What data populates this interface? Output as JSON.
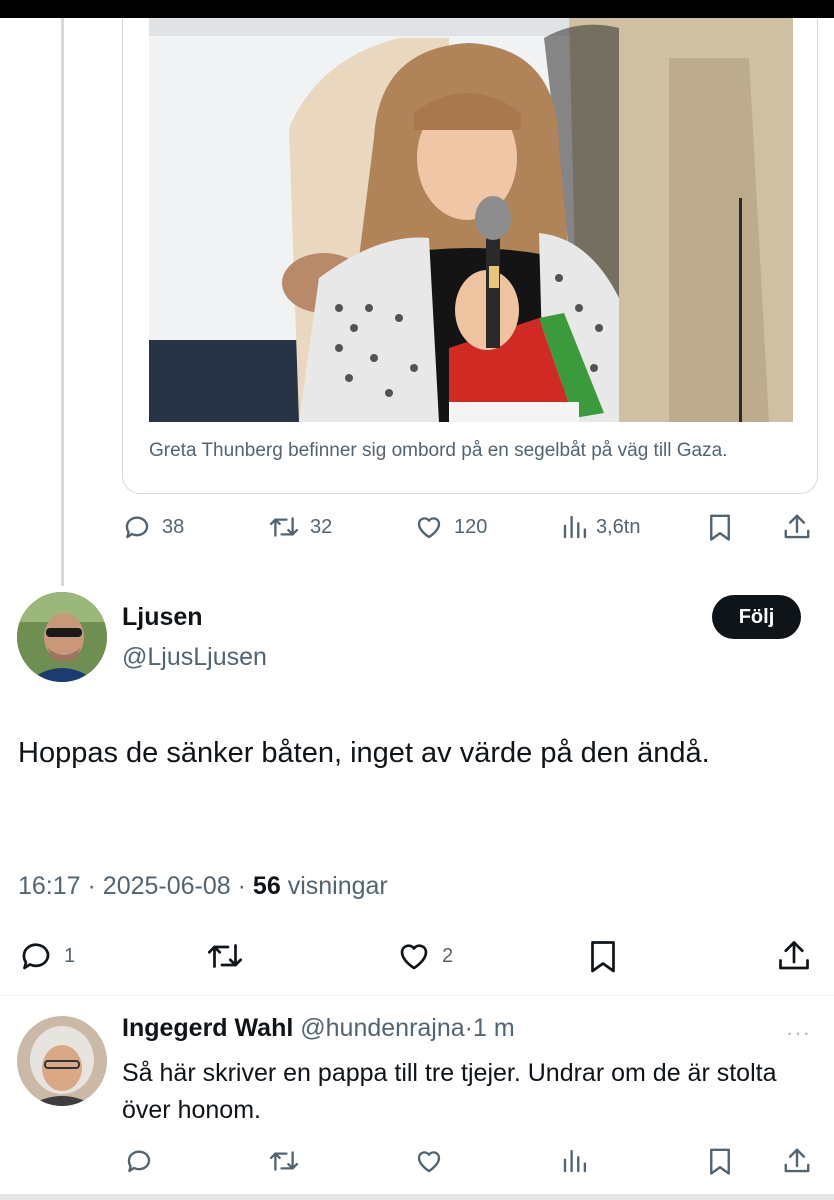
{
  "quoted_post": {
    "photo_alt": "",
    "caption": "Greta Thunberg befinner sig ombord på en segelbåt på väg till Gaza.",
    "actions": {
      "replies": "38",
      "reposts": "32",
      "likes": "120",
      "views": "3,6tn"
    }
  },
  "main_post": {
    "author_name": "Ljusen",
    "author_handle": "@LjusLjusen",
    "follow_label": "Följ",
    "text": "Hoppas de sänker båten, inget av värde på den ändå.",
    "time": "16:17",
    "date": "2025-06-08",
    "views_count": "56",
    "views_label": "visningar",
    "separator": "·",
    "actions": {
      "replies": "1",
      "reposts": "",
      "likes": "2"
    }
  },
  "reply": {
    "author_name": "Ingegerd Wahl",
    "author_handle": "@hundenrajna",
    "age": "1 m",
    "separator": "·",
    "text": "Så här skriver en pappa till tre tjejer. Undrar om de är stolta över honom.",
    "more_label": "···"
  },
  "icons": {
    "reply": "speech-bubble-icon",
    "repost": "repost-arrows-icon",
    "like": "heart-icon",
    "views": "bar-chart-icon",
    "bookmark": "bookmark-icon",
    "share": "share-upload-icon"
  },
  "colors": {
    "text_primary": "#0f1419",
    "text_secondary": "#536471",
    "border": "#cfd9de"
  }
}
